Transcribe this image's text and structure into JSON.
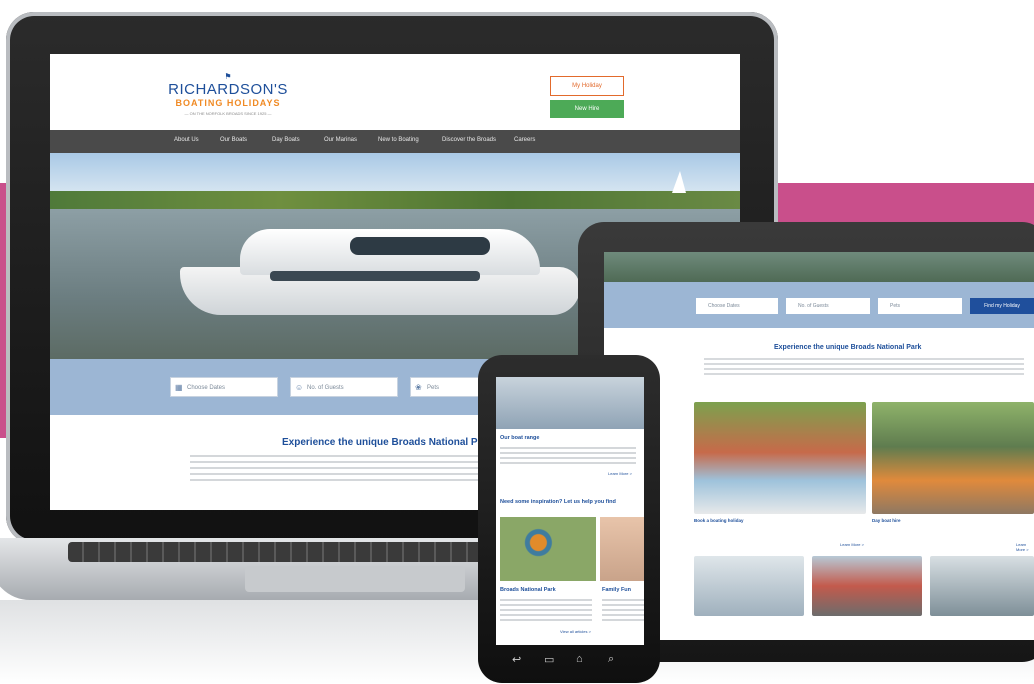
{
  "colors": {
    "brand_blue": "#1e4f9a",
    "orange": "#e26a2c",
    "green": "#4daa57",
    "nav_bg": "#4a4a4a",
    "search_bg": "#9cb6d4",
    "accent_pink": "#c94f8b"
  },
  "logo": {
    "line1": "RICHARDSON'S",
    "line2": "BOATING HOLIDAYS",
    "line3": "— ON THE NORFOLK BROADS SINCE 1925 —"
  },
  "header": {
    "my_holiday": "My Holiday",
    "new_hire": "New Hire"
  },
  "nav": [
    "About Us",
    "Our Boats",
    "Day Boats",
    "Our Marinas",
    "New to Boating",
    "Discover the Broads",
    "Careers"
  ],
  "search": {
    "date": "Choose Dates",
    "guests": "No. of Guests",
    "pets": "Pets",
    "cta": "Find my Holiday"
  },
  "intro": {
    "title": "Experience the unique Broads National Park"
  },
  "tablet": {
    "title": "Experience the unique Broads National Park",
    "cards": [
      "Book a boating holiday",
      "Day boat hire"
    ],
    "more": "Learn More >"
  },
  "phone": {
    "boat_range": "Our boat range",
    "read_more": "Learn More >",
    "inspiration": "Need some inspiration? Let us help you find",
    "card1": "Broads National Park",
    "card2": "Family Fun",
    "view_all": "View all articles >"
  },
  "icons": {
    "calendar": "calendar-icon",
    "guests": "user-icon",
    "pets": "paw-icon",
    "back": "back-icon",
    "recent": "recent-icon",
    "home": "home-icon",
    "search": "search-icon"
  }
}
